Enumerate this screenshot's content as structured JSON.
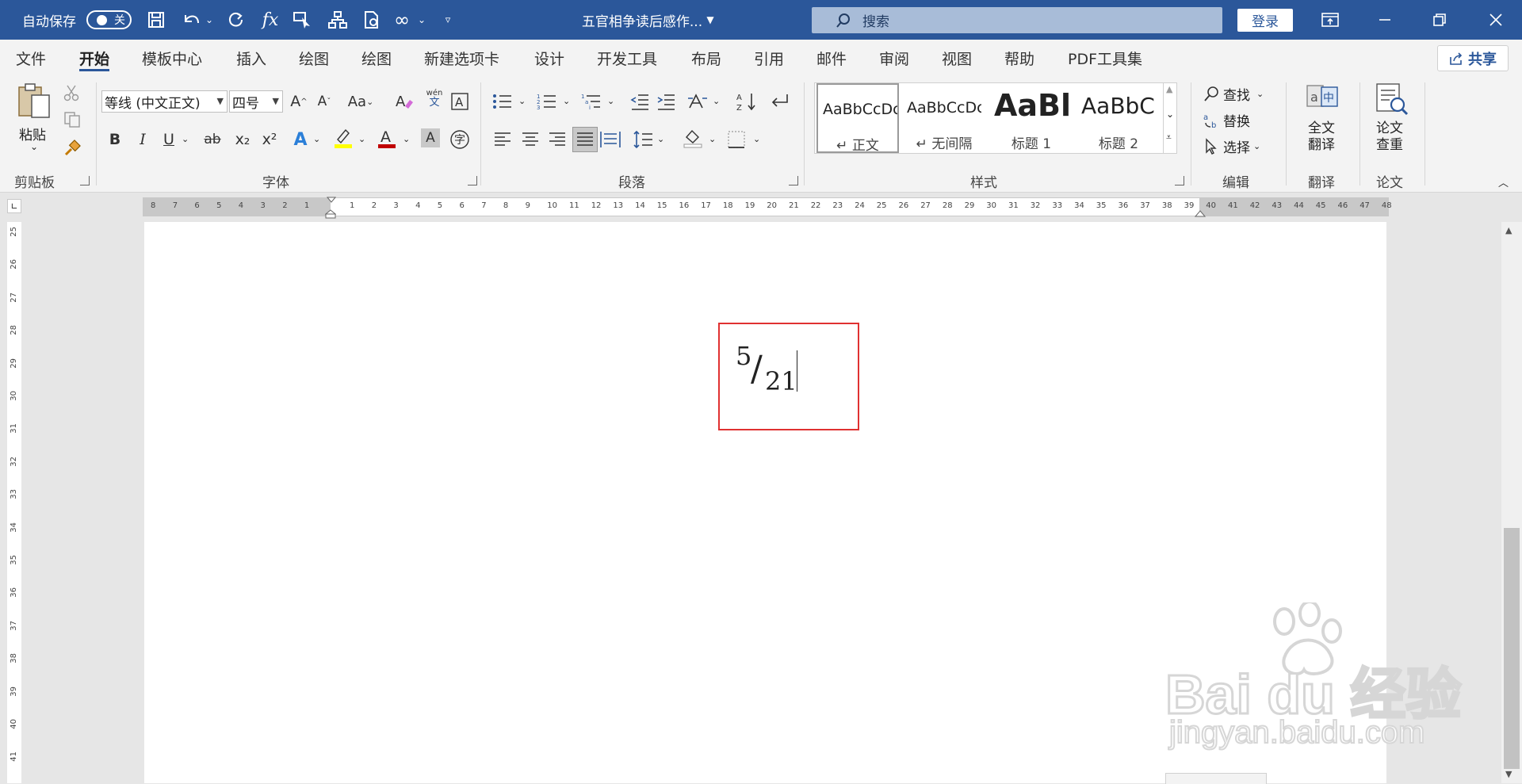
{
  "titlebar": {
    "autosave_label": "自动保存",
    "autosave_state": "关",
    "doc_title": "五官相争读后感作...",
    "search_placeholder": "搜索",
    "login_label": "登录"
  },
  "menu": {
    "tabs": [
      "文件",
      "开始",
      "模板中心",
      "插入",
      "绘图",
      "绘图",
      "新建选项卡",
      "设计",
      "开发工具",
      "布局",
      "引用",
      "邮件",
      "审阅",
      "视图",
      "帮助",
      "PDF工具集"
    ],
    "active_tab": "开始",
    "share_label": "共享"
  },
  "ribbon": {
    "clipboard": {
      "paste_label": "粘贴",
      "group_label": "剪贴板"
    },
    "font": {
      "font_name": "等线 (中文正文)",
      "font_size": "四号",
      "group_label": "字体",
      "bold": "B",
      "italic": "I",
      "underline": "U",
      "strike": "ab",
      "subscript": "x₂",
      "superscript": "x²",
      "case_label": "Aa",
      "phonetic": "wén",
      "phonetic_char": "文",
      "enclose_char": "字",
      "highlight_color": "#ffff00",
      "font_color": "#c00000"
    },
    "paragraph": {
      "group_label": "段落"
    },
    "styles": {
      "group_label": "样式",
      "items": [
        {
          "sample": "AaBbCcDc",
          "name": "↵ 正文"
        },
        {
          "sample": "AaBbCcDc",
          "name": "↵ 无间隔"
        },
        {
          "sample": "AaBl",
          "name": "标题 1"
        },
        {
          "sample": "AaBbC",
          "name": "标题 2"
        }
      ]
    },
    "editing": {
      "find": "查找",
      "replace": "替换",
      "select": "选择",
      "group_label": "编辑"
    },
    "translate": {
      "button": "全文翻译",
      "line1": "全文",
      "line2": "翻译",
      "group_label": "翻译"
    },
    "paper": {
      "line1": "论文",
      "line2": "查重",
      "group_label": "论文"
    }
  },
  "ruler": {
    "left_ticks": [
      "8",
      "7",
      "6",
      "5",
      "4",
      "3",
      "2",
      "1"
    ],
    "right_ticks": [
      "1",
      "2",
      "3",
      "4",
      "5",
      "6",
      "7",
      "8",
      "9",
      "10",
      "11",
      "12",
      "13",
      "14",
      "15",
      "16",
      "17",
      "18",
      "19",
      "20",
      "21",
      "22",
      "23",
      "24",
      "25",
      "26",
      "27",
      "28",
      "29",
      "30",
      "31",
      "32",
      "33",
      "34",
      "35",
      "36",
      "37",
      "38",
      "39",
      "40",
      "41",
      "42",
      "43",
      "44",
      "45",
      "46",
      "47",
      "48"
    ],
    "vertical_ticks": [
      "25",
      "26",
      "27",
      "28",
      "29",
      "30",
      "31",
      "32",
      "33",
      "34",
      "35",
      "36",
      "37",
      "38",
      "39",
      "40",
      "41"
    ]
  },
  "document": {
    "numerator": "5",
    "slash": "/",
    "denominator": "21"
  },
  "watermark": {
    "brand": "Bai du 经验",
    "url": "jingyan.baidu.com"
  }
}
